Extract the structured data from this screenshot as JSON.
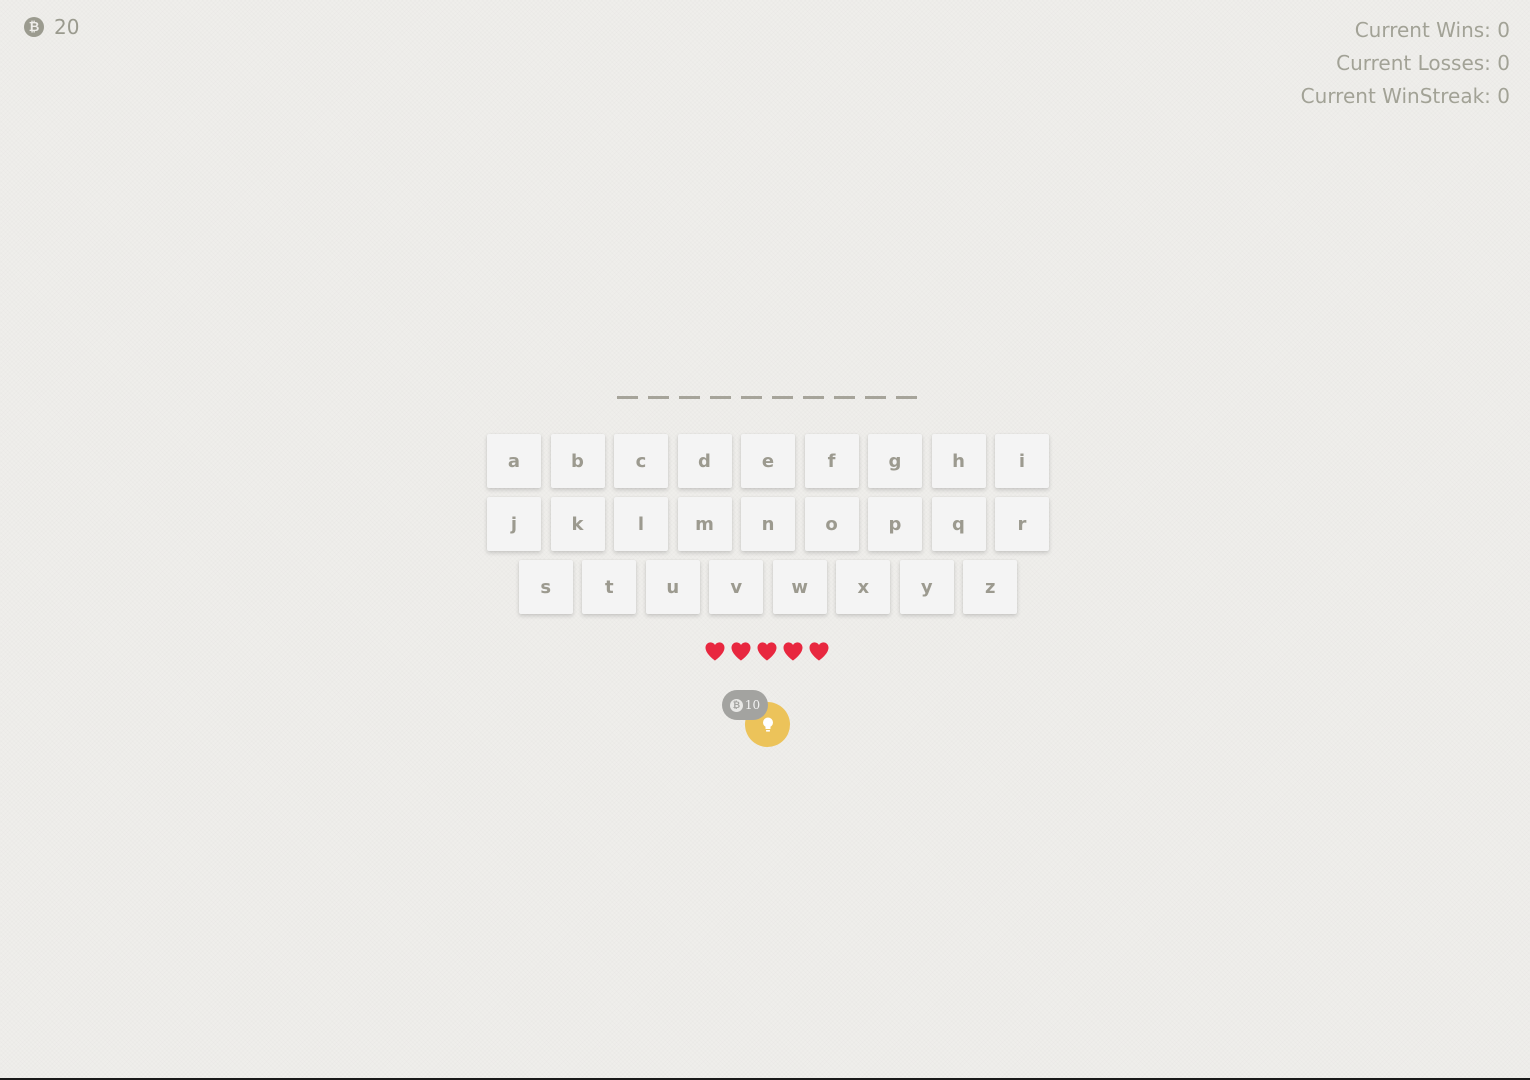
{
  "coins": {
    "icon": "bitcoin-icon",
    "count": "20"
  },
  "stats": {
    "wins": "Current Wins: 0",
    "losses": "Current Losses: 0",
    "winstreak": "Current WinStreak: 0"
  },
  "word": {
    "letter_count": 10
  },
  "keyboard": {
    "rows": [
      [
        "a",
        "b",
        "c",
        "d",
        "e",
        "f",
        "g",
        "h",
        "i"
      ],
      [
        "j",
        "k",
        "l",
        "m",
        "n",
        "o",
        "p",
        "q",
        "r"
      ],
      [
        "s",
        "t",
        "u",
        "v",
        "w",
        "x",
        "y",
        "z"
      ]
    ]
  },
  "lives": {
    "count": 5,
    "icon": "heart-icon",
    "color": "#e8273f"
  },
  "hint": {
    "cost": "10",
    "icon": "lightbulb-icon",
    "button_color": "#ecc35a"
  }
}
